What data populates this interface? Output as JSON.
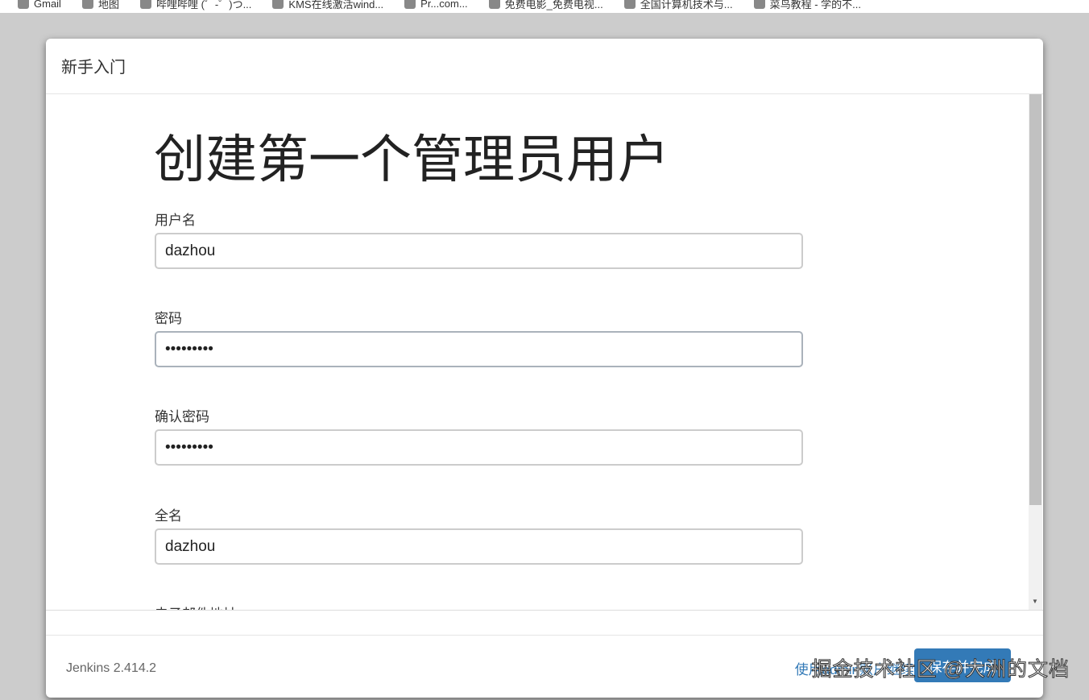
{
  "bookmarks": [
    "Gmail",
    "地图",
    "哔哩哔哩 (゜-゜)つ...",
    "KMS在线激活wind...",
    "Pr...com...",
    "免费电影_免费电视...",
    "全国计算机技术与...",
    "菜鸟教程 - 学的不..."
  ],
  "modal": {
    "title": "新手入门",
    "heading": "创建第一个管理员用户",
    "fields": [
      {
        "label": "用户名",
        "value": "dazhou",
        "type": "text"
      },
      {
        "label": "密码",
        "value": "password1",
        "type": "password"
      },
      {
        "label": "确认密码",
        "value": "password1",
        "type": "password"
      },
      {
        "label": "全名",
        "value": "dazhou",
        "type": "text"
      },
      {
        "label": "电子邮件地址",
        "value": "",
        "type": "text"
      }
    ]
  },
  "footer": {
    "version": "Jenkins 2.414.2",
    "skip_link": "使用admin账户继续",
    "save_button": "保存并完成"
  },
  "watermark": "掘金技术社区 @大洲的文档"
}
